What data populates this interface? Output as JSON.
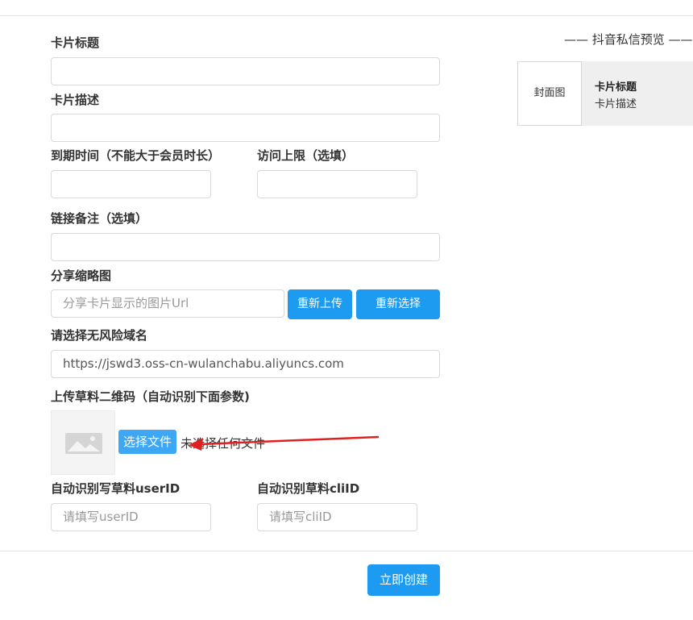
{
  "form": {
    "card_title_label": "卡片标题",
    "card_title_value": "",
    "card_desc_label": "卡片描述",
    "card_desc_value": "",
    "expiry_label": "到期时间（不能大于会员时长）",
    "expiry_value": "",
    "visit_limit_label": "访问上限（选填）",
    "visit_limit_value": "",
    "link_note_label": "链接备注（选填）",
    "link_note_value": "",
    "share_thumb_label": "分享缩略图",
    "share_thumb_placeholder": "分享卡片显示的图片Url",
    "reupload_label": "重新上传",
    "reselect_label": "重新选择",
    "domain_label": "请选择无风险域名",
    "domain_value": "https://jswd3.oss-cn-wulanchabu.aliyuncs.com",
    "qr_label": "上传草料二维码（自动识别下面参数)",
    "choose_file_label": "选择文件",
    "no_file_label": "未选择任何文件",
    "userid_label": "自动识别写草料userID",
    "userid_placeholder": "请填写userID",
    "cliid_label": "自动识别草料cliID",
    "cliid_placeholder": "请填写cliID",
    "submit_label": "立即创建"
  },
  "preview": {
    "heading": "—— 抖音私信预览 ——",
    "cover_label": "封面图",
    "card_title": "卡片标题",
    "card_desc": "卡片描述"
  },
  "colors": {
    "primary": "#1d9bf0",
    "file_button": "#3ea7f5",
    "annotation_arrow": "#e02020"
  },
  "icons": {
    "thumbnail": "image-placeholder-icon"
  }
}
